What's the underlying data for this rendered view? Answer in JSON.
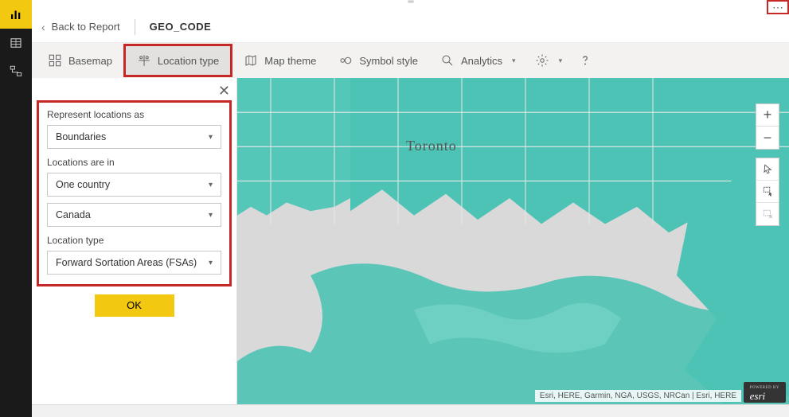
{
  "corner_menu_glyph": "⋯",
  "breadcrumb": {
    "back_label": "Back to Report",
    "title": "GEO_CODE"
  },
  "toolbar": {
    "basemap": "Basemap",
    "location_type": "Location type",
    "map_theme": "Map theme",
    "symbol_style": "Symbol style",
    "analytics": "Analytics"
  },
  "panel": {
    "represent_label": "Represent locations as",
    "represent_value": "Boundaries",
    "locations_in_label": "Locations are in",
    "locations_in_value": "One country",
    "country_value": "Canada",
    "location_type_label": "Location type",
    "location_type_value": "Forward Sortation Areas (FSAs)",
    "ok_label": "OK"
  },
  "map": {
    "city_label": "Toronto",
    "attribution": "Esri, HERE, Garmin, NGA, USGS, NRCan | Esri, HERE",
    "esri_powered": "POWERED BY",
    "esri_brand": "esri"
  },
  "colors": {
    "teal": "#4cc3b4",
    "teal_light": "#6dd0c2",
    "land_grey": "#d9d9d9",
    "road_grey": "#e8e8e8",
    "highlight_red": "#c62828",
    "pbi_yellow": "#f2c811"
  }
}
